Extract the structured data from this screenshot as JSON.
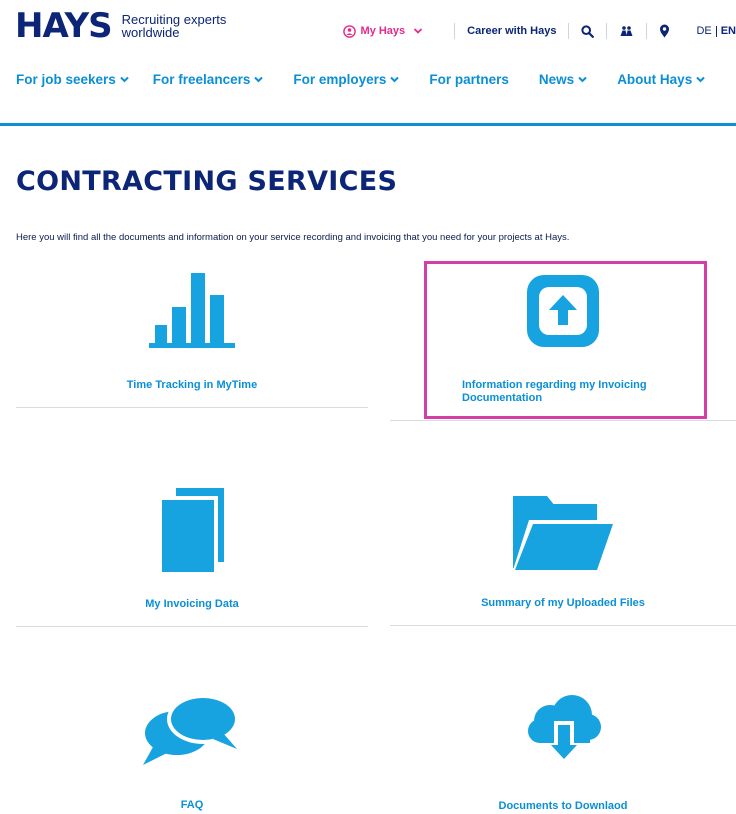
{
  "brand": {
    "logo_text": "HAYS",
    "tagline_line1": "Recruiting experts",
    "tagline_line2": "worldwide"
  },
  "utility": {
    "my_hays": "My Hays",
    "career": "Career with Hays",
    "lang_de": "DE",
    "lang_en": "EN",
    "icons": [
      "user-circle-icon",
      "search-icon",
      "people-icon",
      "location-pin-icon"
    ]
  },
  "nav": {
    "items": [
      {
        "label": "For job seekers",
        "has_menu": true
      },
      {
        "label": "For freelancers",
        "has_menu": true
      },
      {
        "label": "For employers",
        "has_menu": true
      },
      {
        "label": "For partners",
        "has_menu": false
      },
      {
        "label": "News",
        "has_menu": true
      },
      {
        "label": "About Hays",
        "has_menu": true
      }
    ]
  },
  "page": {
    "title": "CONTRACTING SERVICES",
    "intro": "Here you will find all the documents and information on your service recording and invoicing that you need for your projects at Hays."
  },
  "tiles": [
    {
      "label": "Time Tracking in MyTime",
      "icon": "bar-chart-icon"
    },
    {
      "label": "Information regarding my Invoicing Documentation",
      "icon": "upload-box-icon"
    },
    {
      "label": "My Invoicing Data",
      "icon": "documents-icon"
    },
    {
      "label": "Summary of my Uploaded Files",
      "icon": "folder-icon"
    },
    {
      "label": "FAQ",
      "icon": "chat-bubbles-icon"
    },
    {
      "label": "Documents to Downlaod",
      "icon": "cloud-download-icon"
    }
  ],
  "colors": {
    "brand_blue": "#0c2577",
    "accent_blue": "#0a8fd6",
    "icon_blue": "#16a3e0",
    "pink": "#e52a8a",
    "highlight": "#d43fa6"
  }
}
